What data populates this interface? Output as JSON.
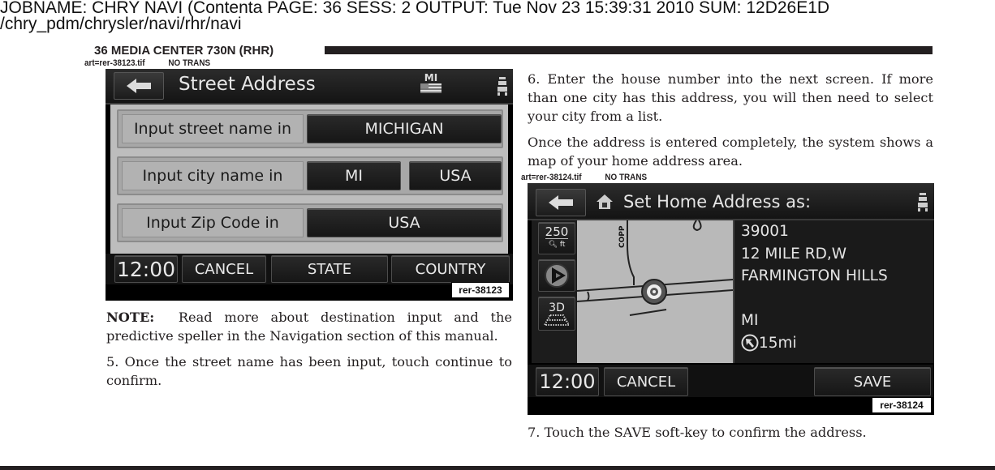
{
  "print_header": {
    "line1": "JOBNAME: CHRY NAVI (Contenta   PAGE: 36  SESS: 2  OUTPUT: Tue Nov 23 15:39:31 2010  SUM: 12D26E1D",
    "line2": "/chry_pdm/chrysler/navi/rhr/navi"
  },
  "running_head": "36   MEDIA CENTER 730N (RHR)",
  "figure1": {
    "art_label": "art=rer-38123.tif",
    "trans_label": "NO TRANS",
    "screen_title": "Street Address",
    "state_indicator": "MI",
    "icons": {
      "back": "back-arrow-icon",
      "flag": "us-flag-icon",
      "seat": "passenger-seat-icon"
    },
    "rows": [
      {
        "label": "Input street name in",
        "buttons": [
          "MICHIGAN"
        ]
      },
      {
        "label": "Input city name in",
        "buttons": [
          "MI",
          "USA"
        ]
      },
      {
        "label": "Input Zip Code in",
        "buttons": [
          "USA"
        ]
      }
    ],
    "bottom_bar": {
      "clock": "12:00",
      "buttons": [
        "CANCEL",
        "STATE",
        "COUNTRY"
      ]
    },
    "ref_tag": "rer-38123"
  },
  "left_text": {
    "note_label": "NOTE:",
    "note_body": "Read more about destination input and the predictive speller in the Navigation section of this manual.",
    "step5": "5.  Once the street name has been input, touch continue to confirm."
  },
  "right_text": {
    "step6": "6.  Enter the house number into the next screen. If more than one city has this address, you will then need to select your city from a list.",
    "para": "Once the address is entered completely, the system shows a map of your home address area.",
    "step7": "7.  Touch the SAVE soft-key to confirm the address."
  },
  "figure2": {
    "art_label": "art=rer-38124.tif",
    "trans_label": "NO TRANS",
    "screen_title": "Set Home Address as:",
    "icons": {
      "back": "back-arrow-icon",
      "home": "home-icon",
      "seat": "passenger-seat-icon"
    },
    "map_controls": {
      "zoom_value": "250",
      "zoom_unit": "ft",
      "view_mode": "3D"
    },
    "map_street_label": "COPP",
    "address_lines": [
      "39001",
      "12 MILE RD,W",
      "FARMINGTON HILLS",
      "",
      "MI"
    ],
    "distance": "15mi",
    "bottom_bar": {
      "clock": "12:00",
      "cancel": "CANCEL",
      "save": "SAVE"
    },
    "ref_tag": "rer-38124"
  }
}
